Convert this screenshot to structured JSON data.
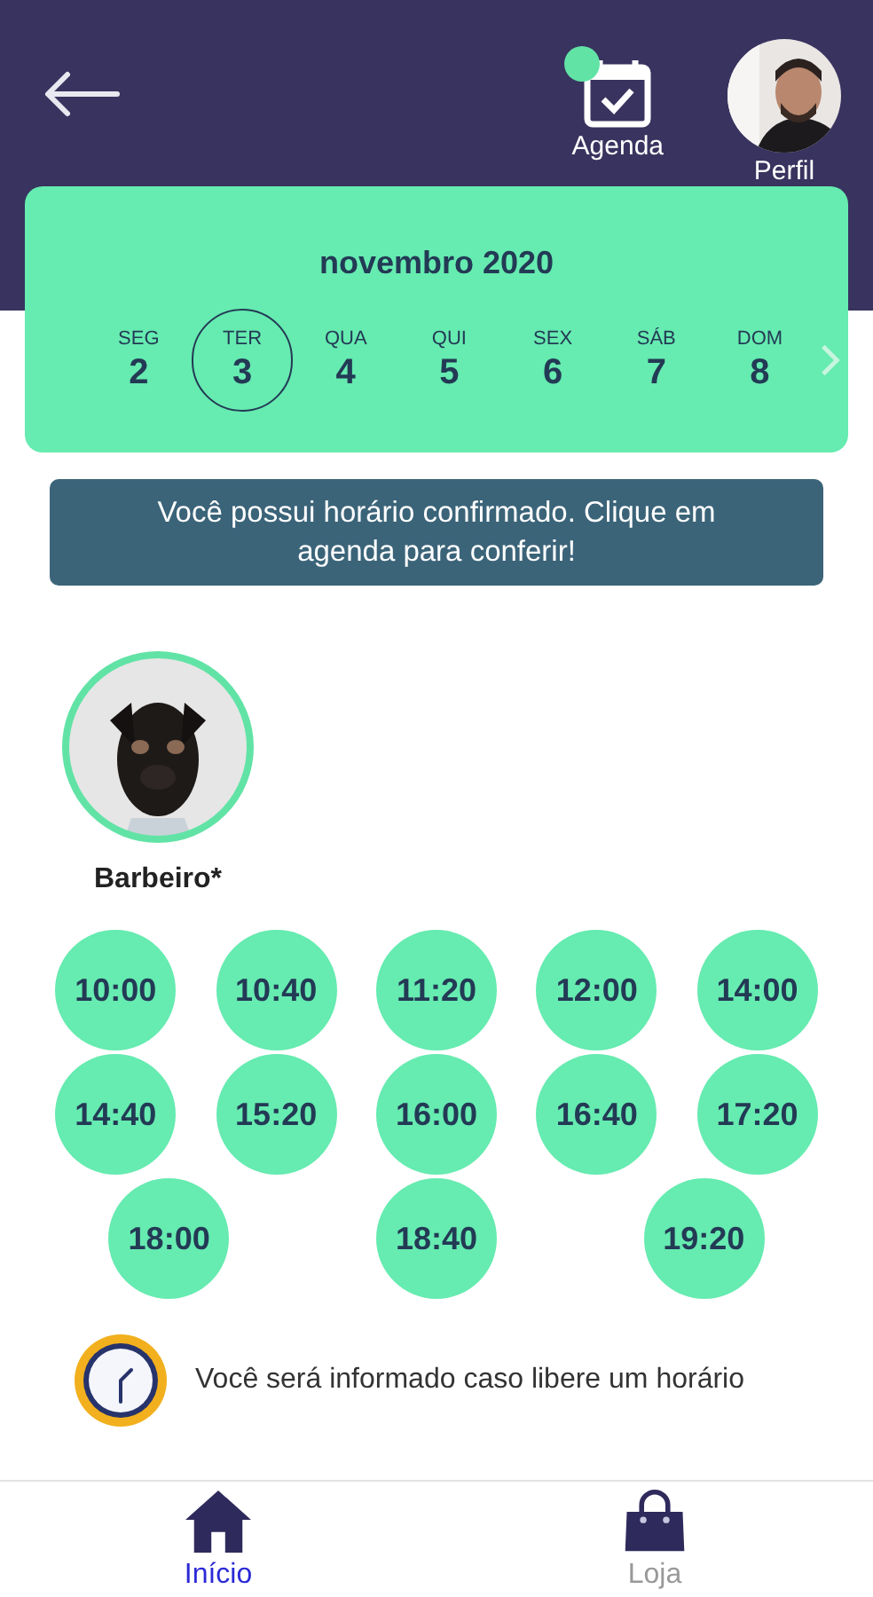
{
  "header": {
    "agenda_label": "Agenda",
    "agenda_badge": true,
    "profile_label": "Perfil"
  },
  "calendar": {
    "month": "novembro 2020",
    "days": [
      {
        "weekday": "SEG",
        "day": "2",
        "selected": false
      },
      {
        "weekday": "TER",
        "day": "3",
        "selected": true
      },
      {
        "weekday": "QUA",
        "day": "4",
        "selected": false
      },
      {
        "weekday": "QUI",
        "day": "5",
        "selected": false
      },
      {
        "weekday": "SEX",
        "day": "6",
        "selected": false
      },
      {
        "weekday": "SÁB",
        "day": "7",
        "selected": false
      },
      {
        "weekday": "DOM",
        "day": "8",
        "selected": false
      }
    ]
  },
  "notice": "Você possui horário confirmado. Clique em agenda para conferir!",
  "barber": {
    "name": "Barbeiro*"
  },
  "slots": [
    [
      "10:00",
      "10:40",
      "11:20",
      "12:00",
      "14:00"
    ],
    [
      "14:40",
      "15:20",
      "16:00",
      "16:40",
      "17:20"
    ],
    [
      "18:00",
      "18:40",
      "19:20"
    ]
  ],
  "waitlist": "Você será informado caso libere um horário",
  "nav": [
    {
      "label": "Início",
      "kind": "home",
      "selected": true
    },
    {
      "label": "Loja",
      "kind": "shop",
      "selected": false
    }
  ]
}
